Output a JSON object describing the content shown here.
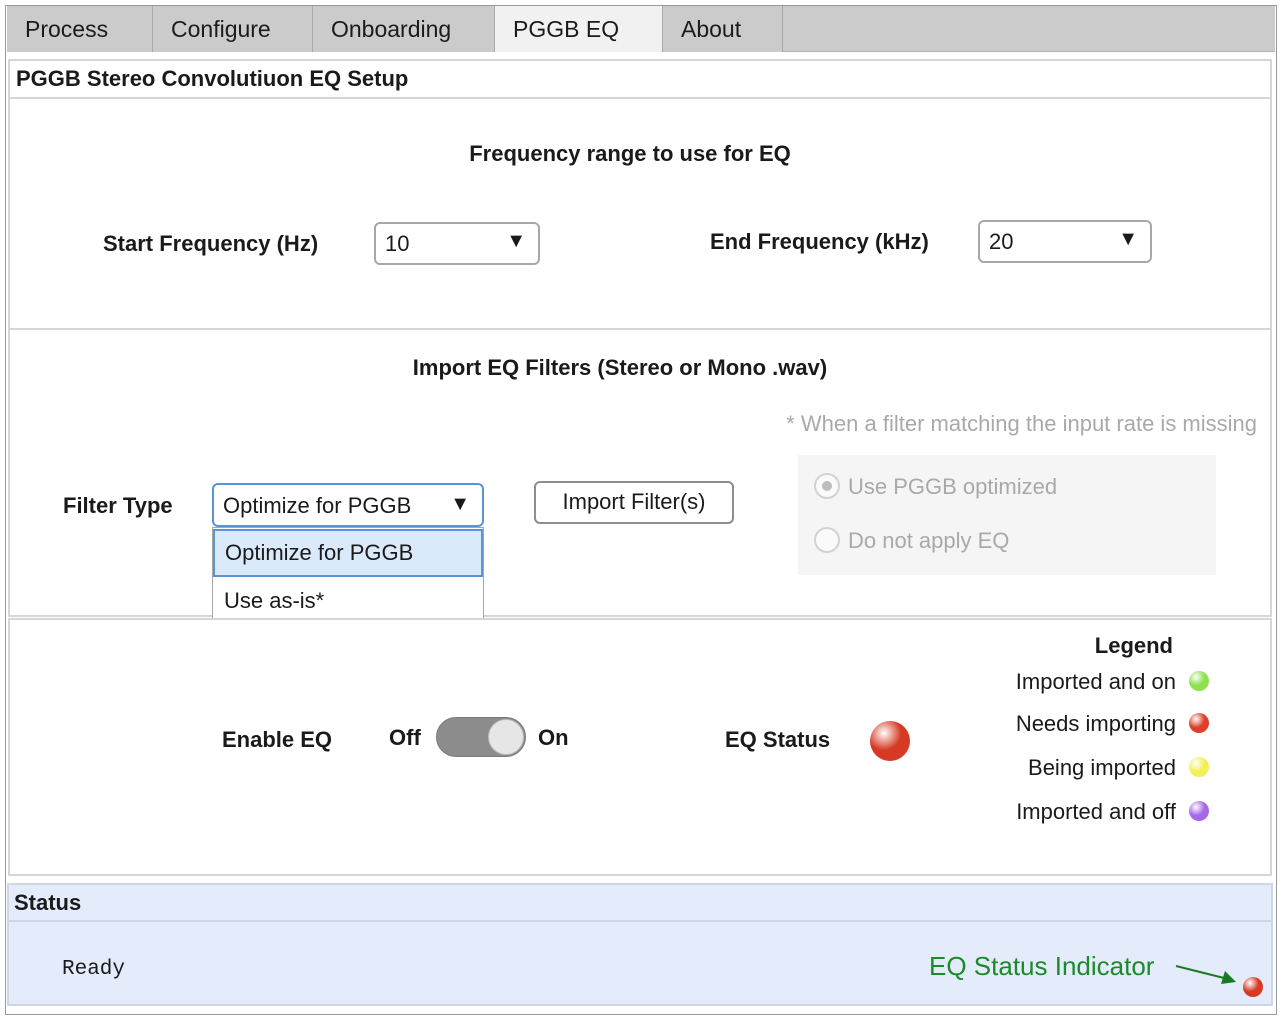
{
  "tabs": [
    {
      "label": "Process"
    },
    {
      "label": "Configure"
    },
    {
      "label": "Onboarding"
    },
    {
      "label": "PGGB EQ"
    },
    {
      "label": "About"
    }
  ],
  "panel_title": "PGGB Stereo Convolutiuon EQ Setup",
  "frequency": {
    "title": "Frequency range to use for EQ",
    "start_label": "Start  Frequency (Hz)",
    "start_value": "10",
    "end_label": "End Frequency (kHz)",
    "end_value": "20"
  },
  "import": {
    "title": "Import EQ Filters (Stereo or Mono .wav)",
    "note": "* When a filter matching the input rate is missing",
    "filter_type_label": "Filter Type",
    "filter_type_value": "Optimize for PGGB",
    "options": [
      "Optimize for PGGB",
      "Use as-is*"
    ],
    "import_button": "Import Filter(s)",
    "radio_options": [
      "Use PGGB optimized",
      "Do not apply EQ"
    ]
  },
  "eq": {
    "enable_label": "Enable EQ",
    "off_label": "Off",
    "on_label": "On",
    "status_label": "EQ Status",
    "status_color": "#d63a24"
  },
  "legend": {
    "title": "Legend",
    "items": [
      {
        "label": "Imported and on",
        "color": "#8ee04f"
      },
      {
        "label": "Needs importing",
        "color": "#de3f2a"
      },
      {
        "label": "Being imported",
        "color": "#f4ef58"
      },
      {
        "label": "Imported and off",
        "color": "#a768e8"
      }
    ]
  },
  "status": {
    "title": "Status",
    "text": "Ready",
    "indicator_label": "EQ Status Indicator",
    "indicator_color": "#d63a24"
  }
}
